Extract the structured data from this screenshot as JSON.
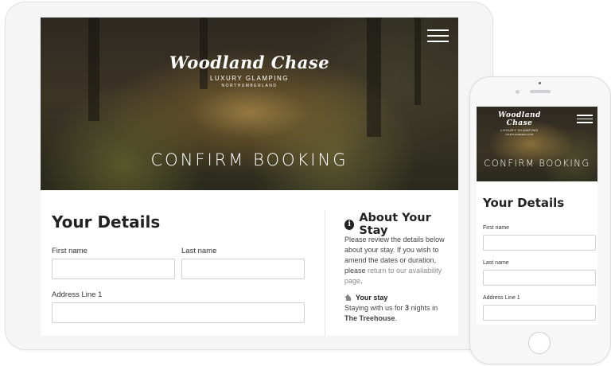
{
  "brand": {
    "name": "Woodland Chase",
    "tagline": "LUXURY GLAMPING",
    "location": "NORTHUMBERLAND"
  },
  "hero": {
    "title": "CONFIRM BOOKING"
  },
  "form": {
    "heading": "Your Details",
    "first_name_label": "First name",
    "last_name_label": "Last name",
    "address1_label": "Address Line 1"
  },
  "aside": {
    "title": "About Your Stay",
    "intro_before": "Please review the details below about your stay. If you wish to amend the dates or duration, please ",
    "intro_link": "return to our availability page",
    "intro_after": ".",
    "stay_heading": "Your stay",
    "stay_prefix": "Staying with us for ",
    "stay_nights": "3",
    "stay_mid": " nights in ",
    "stay_property": "The Treehouse",
    "stay_suffix": "."
  },
  "colors": {
    "link": "#8b8b8b",
    "text": "#222222",
    "field_border": "#cfcfd3"
  },
  "icons": {
    "menu": "hamburger-menu-icon",
    "info": "info-circle-icon",
    "stay": "house-icon"
  }
}
